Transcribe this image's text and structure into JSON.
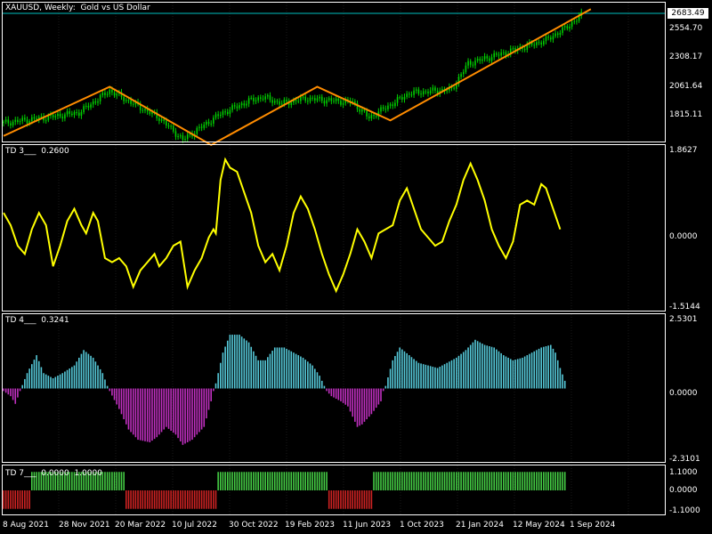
{
  "window": {
    "title": "XAUUSD, Weekly:  Gold vs US Dollar",
    "current_price": "2683.49"
  },
  "colors": {
    "background": "#000000",
    "grid": "#1a1a1a",
    "axis": "#ffffff",
    "candles": "#00d000",
    "zigzag": "#ff8c00",
    "td3_line": "#ffff00",
    "td4_positive": "#55c8d8",
    "td4_negative": "#c030c0",
    "td7_positive": "#44cc44",
    "td7_negative": "#cc2222",
    "current_price_line": "#00c0c0"
  },
  "price_pane": {
    "axis_labels": [
      "2554.70",
      "2308.17",
      "2061.64",
      "1815.11"
    ]
  },
  "td3_pane": {
    "title": "TD 3___  0.2600",
    "axis_labels": [
      "1.8627",
      "0.0000",
      "-1.5144"
    ]
  },
  "td4_pane": {
    "title": "TD 4___  0.3241",
    "axis_labels": [
      "2.5301",
      "0.0000",
      "-2.3101"
    ]
  },
  "td7_pane": {
    "title": "TD 7___  0.0000  1.0000",
    "axis_labels": [
      "1.1000",
      "0.0000",
      "-1.1000"
    ]
  },
  "time_axis": {
    "labels": [
      "8 Aug 2021",
      "28 Nov 2021",
      "20 Mar 2022",
      "10 Jul 2022",
      "30 Oct 2022",
      "19 Feb 2023",
      "11 Jun 2023",
      "1 Oct 2023",
      "21 Jan 2024",
      "12 May 2024",
      "1 Sep 2024"
    ]
  },
  "chart_data": [
    {
      "type": "candlestick",
      "title": "XAUUSD, Weekly:  Gold vs US Dollar",
      "y_ticks": [
        1815.11,
        2061.64,
        2308.17,
        2554.7
      ],
      "ylim": [
        1640,
        2720
      ],
      "close_keypoints": [
        [
          0,
          1790
        ],
        [
          17,
          1830
        ],
        [
          32,
          1870
        ],
        [
          45,
          2040
        ],
        [
          66,
          1830
        ],
        [
          76,
          1660
        ],
        [
          92,
          1860
        ],
        [
          104,
          1960
        ],
        [
          110,
          1990
        ],
        [
          118,
          1940
        ],
        [
          128,
          1980
        ],
        [
          148,
          1950
        ],
        [
          155,
          1830
        ],
        [
          172,
          2020
        ],
        [
          190,
          2050
        ],
        [
          197,
          2250
        ],
        [
          214,
          2340
        ],
        [
          230,
          2430
        ],
        [
          238,
          2520
        ],
        [
          245,
          2623
        ]
      ],
      "zigzag": [
        [
          0,
          1690
        ],
        [
          45,
          2070
        ],
        [
          88,
          1620
        ],
        [
          133,
          2070
        ],
        [
          164,
          1810
        ],
        [
          249,
          2670
        ]
      ],
      "current_price": 2683.49
    },
    {
      "type": "line",
      "title": "TD 3",
      "last_value": 0.26,
      "y_ticks": [
        -1.5144,
        0,
        1.8627
      ],
      "ylim": [
        -1.9,
        2.15
      ],
      "points": [
        [
          0,
          0.5
        ],
        [
          3,
          0.2
        ],
        [
          6,
          -0.3
        ],
        [
          9,
          -0.5
        ],
        [
          12,
          0.1
        ],
        [
          15,
          0.5
        ],
        [
          18,
          0.2
        ],
        [
          21,
          -0.8
        ],
        [
          24,
          -0.3
        ],
        [
          27,
          0.3
        ],
        [
          30,
          0.6
        ],
        [
          33,
          0.2
        ],
        [
          35,
          0.0
        ],
        [
          38,
          0.5
        ],
        [
          40,
          0.3
        ],
        [
          43,
          -0.6
        ],
        [
          46,
          -0.7
        ],
        [
          49,
          -0.6
        ],
        [
          52,
          -0.8
        ],
        [
          55,
          -1.3
        ],
        [
          58,
          -0.9
        ],
        [
          61,
          -0.7
        ],
        [
          64,
          -0.5
        ],
        [
          66,
          -0.8
        ],
        [
          69,
          -0.6
        ],
        [
          72,
          -0.3
        ],
        [
          75,
          -0.2
        ],
        [
          78,
          -1.3
        ],
        [
          81,
          -0.9
        ],
        [
          84,
          -0.6
        ],
        [
          87,
          -0.1
        ],
        [
          89,
          0.1
        ],
        [
          90,
          0.0
        ],
        [
          92,
          1.3
        ],
        [
          94,
          1.8
        ],
        [
          96,
          1.6
        ],
        [
          99,
          1.5
        ],
        [
          102,
          1.0
        ],
        [
          105,
          0.5
        ],
        [
          108,
          -0.3
        ],
        [
          111,
          -0.7
        ],
        [
          114,
          -0.5
        ],
        [
          117,
          -0.9
        ],
        [
          120,
          -0.3
        ],
        [
          123,
          0.5
        ],
        [
          126,
          0.9
        ],
        [
          129,
          0.6
        ],
        [
          132,
          0.1
        ],
        [
          135,
          -0.5
        ],
        [
          138,
          -1.0
        ],
        [
          141,
          -1.4
        ],
        [
          144,
          -1.0
        ],
        [
          147,
          -0.5
        ],
        [
          150,
          0.1
        ],
        [
          153,
          -0.2
        ],
        [
          156,
          -0.6
        ],
        [
          159,
          0.0
        ],
        [
          162,
          0.1
        ],
        [
          165,
          0.2
        ],
        [
          168,
          0.8
        ],
        [
          171,
          1.1
        ],
        [
          174,
          0.6
        ],
        [
          177,
          0.1
        ],
        [
          180,
          -0.1
        ],
        [
          183,
          -0.3
        ],
        [
          186,
          -0.2
        ],
        [
          189,
          0.3
        ],
        [
          192,
          0.7
        ],
        [
          195,
          1.3
        ],
        [
          198,
          1.7
        ],
        [
          201,
          1.3
        ],
        [
          204,
          0.8
        ],
        [
          207,
          0.1
        ],
        [
          210,
          -0.3
        ],
        [
          213,
          -0.6
        ],
        [
          216,
          -0.2
        ],
        [
          219,
          0.7
        ],
        [
          222,
          0.8
        ],
        [
          225,
          0.7
        ],
        [
          228,
          1.2
        ],
        [
          230,
          1.1
        ],
        [
          233,
          0.6
        ],
        [
          236,
          0.1
        ]
      ]
    },
    {
      "type": "bar",
      "title": "TD 4",
      "last_value": 0.3241,
      "y_ticks": [
        -2.3101,
        0,
        2.5301
      ],
      "ylim": [
        -2.9,
        2.9
      ],
      "points": [
        [
          0,
          -0.1
        ],
        [
          3,
          -0.3
        ],
        [
          5,
          -0.6
        ],
        [
          7,
          -0.1
        ],
        [
          10,
          0.6
        ],
        [
          14,
          1.3
        ],
        [
          17,
          0.6
        ],
        [
          21,
          0.4
        ],
        [
          25,
          0.6
        ],
        [
          30,
          0.9
        ],
        [
          34,
          1.5
        ],
        [
          38,
          1.2
        ],
        [
          42,
          0.6
        ],
        [
          44,
          0.1
        ],
        [
          45,
          -0.1
        ],
        [
          49,
          -0.8
        ],
        [
          53,
          -1.6
        ],
        [
          57,
          -2.0
        ],
        [
          62,
          -2.1
        ],
        [
          65,
          -1.9
        ],
        [
          69,
          -1.5
        ],
        [
          73,
          -1.8
        ],
        [
          76,
          -2.2
        ],
        [
          80,
          -2.0
        ],
        [
          85,
          -1.5
        ],
        [
          88,
          -0.5
        ],
        [
          89,
          -0.1
        ],
        [
          90,
          0.2
        ],
        [
          93,
          1.4
        ],
        [
          96,
          2.1
        ],
        [
          100,
          2.1
        ],
        [
          104,
          1.8
        ],
        [
          108,
          1.1
        ],
        [
          111,
          1.1
        ],
        [
          115,
          1.6
        ],
        [
          119,
          1.6
        ],
        [
          123,
          1.4
        ],
        [
          127,
          1.2
        ],
        [
          131,
          0.9
        ],
        [
          134,
          0.5
        ],
        [
          136,
          0.1
        ],
        [
          137,
          -0.1
        ],
        [
          139,
          -0.3
        ],
        [
          143,
          -0.5
        ],
        [
          146,
          -0.7
        ],
        [
          150,
          -1.5
        ],
        [
          152,
          -1.4
        ],
        [
          156,
          -1.0
        ],
        [
          160,
          -0.5
        ],
        [
          161,
          -0.1
        ],
        [
          162,
          0.1
        ],
        [
          165,
          1.1
        ],
        [
          168,
          1.6
        ],
        [
          172,
          1.3
        ],
        [
          176,
          1.0
        ],
        [
          180,
          0.9
        ],
        [
          184,
          0.8
        ],
        [
          188,
          1.0
        ],
        [
          192,
          1.2
        ],
        [
          196,
          1.5
        ],
        [
          200,
          1.9
        ],
        [
          204,
          1.7
        ],
        [
          208,
          1.6
        ],
        [
          212,
          1.3
        ],
        [
          216,
          1.1
        ],
        [
          220,
          1.2
        ],
        [
          224,
          1.4
        ],
        [
          228,
          1.6
        ],
        [
          232,
          1.7
        ],
        [
          234,
          1.4
        ],
        [
          236,
          0.8
        ],
        [
          238,
          0.3
        ]
      ]
    },
    {
      "type": "bar",
      "title": "TD 7",
      "values_label": "0.0000  1.0000",
      "y_ticks": [
        -1.1,
        0,
        1.1
      ],
      "ylim": [
        -1.35,
        1.35
      ],
      "segments": [
        [
          0,
          11,
          -1
        ],
        [
          12,
          51,
          1
        ],
        [
          52,
          90,
          -1
        ],
        [
          91,
          137,
          1
        ],
        [
          138,
          156,
          -1
        ],
        [
          157,
          238,
          1
        ]
      ]
    }
  ]
}
